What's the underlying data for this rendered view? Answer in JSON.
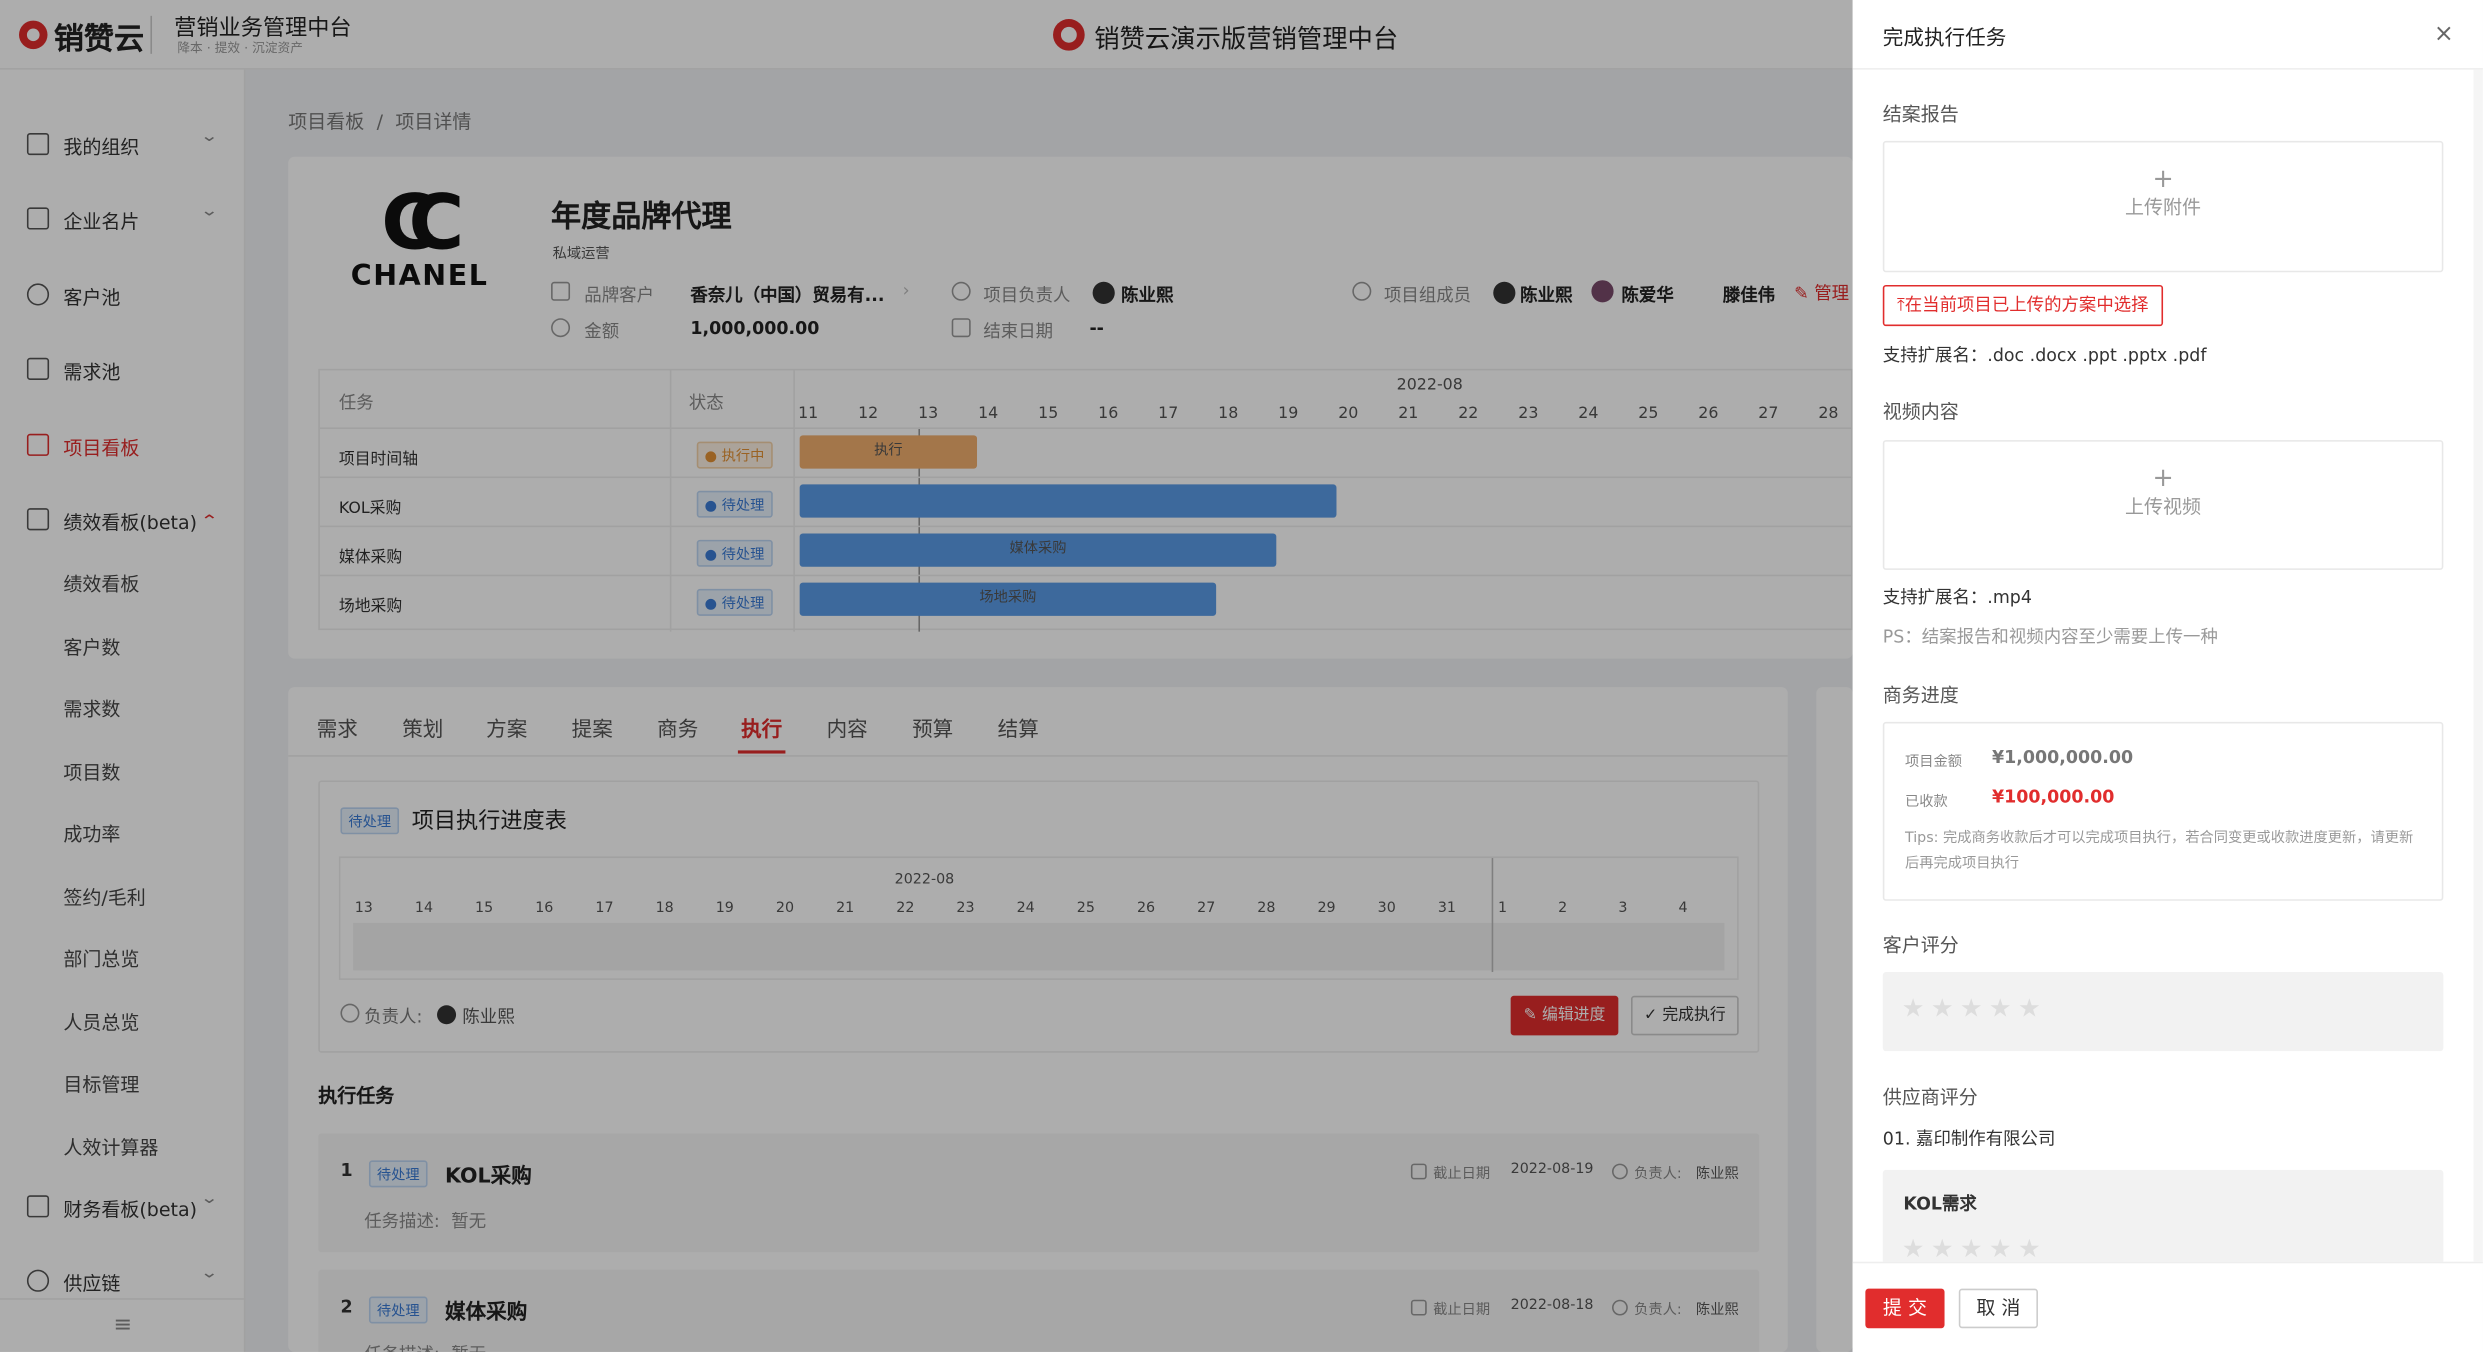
{
  "header": {
    "logo_text": "销赞云",
    "system_title": "营销业务管理中台",
    "system_sub": "降本 · 提效 · 沉淀资产",
    "center_title": "销赞云演示版营销管理中台"
  },
  "sidebar": {
    "items": [
      {
        "label": "我的组织",
        "icon": "org-icon"
      },
      {
        "label": "企业名片",
        "icon": "building-icon"
      },
      {
        "label": "客户池",
        "icon": "user-icon"
      },
      {
        "label": "需求池",
        "icon": "list-icon"
      },
      {
        "label": "项目看板",
        "icon": "board-icon"
      },
      {
        "label": "绩效看板(beta)",
        "icon": "chart-icon"
      },
      {
        "label": "财务看板(beta)",
        "icon": "yen-icon"
      },
      {
        "label": "供应链",
        "icon": "network-icon"
      }
    ],
    "sub_items": [
      "绩效看板",
      "客户数",
      "需求数",
      "项目数",
      "成功率",
      "签约/毛利",
      "部门总览",
      "人员总览",
      "目标管理",
      "人效计算器"
    ],
    "collapse": "≡"
  },
  "breadcrumb": {
    "root": "项目看板",
    "sep": "/",
    "current": "项目详情"
  },
  "project": {
    "logo_text": "CHANEL",
    "title": "年度品牌代理",
    "tag": "私域运营",
    "brand_label": "品牌客户",
    "brand_value": "香奈儿（中国）贸易有...",
    "amount_label": "金额",
    "amount_value": "1,000,000.00",
    "owner_label": "项目负责人",
    "owner_value": "陈业熙",
    "end_label": "结束日期",
    "end_value": "--",
    "members_label": "项目组成员",
    "members": [
      "陈业熙",
      "陈爱华",
      "滕佳伟"
    ],
    "manage": "管理"
  },
  "gantt": {
    "col_task": "任务",
    "col_status": "状态",
    "month": "2022-08",
    "days": [
      "11",
      "12",
      "13",
      "14",
      "15",
      "16",
      "17",
      "18",
      "19",
      "20",
      "21",
      "22",
      "23",
      "24",
      "25",
      "26",
      "27",
      "28"
    ],
    "rows": [
      {
        "task": "项目时间轴",
        "status": "执行中",
        "bar_label": "执行"
      },
      {
        "task": "KOL采购",
        "status": "待处理",
        "bar_label": ""
      },
      {
        "task": "媒体采购",
        "status": "待处理",
        "bar_label": "媒体采购"
      },
      {
        "task": "场地采购",
        "status": "待处理",
        "bar_label": "场地采购"
      }
    ]
  },
  "tabs": [
    "需求",
    "策划",
    "方案",
    "提案",
    "商务",
    "执行",
    "内容",
    "预算",
    "结算"
  ],
  "progress": {
    "badge": "待处理",
    "title": "项目执行进度表",
    "month": "2022-08",
    "days": [
      "13",
      "14",
      "15",
      "16",
      "17",
      "18",
      "19",
      "20",
      "21",
      "22",
      "23",
      "24",
      "25",
      "26",
      "27",
      "28",
      "29",
      "30",
      "31",
      "1",
      "2",
      "3",
      "4"
    ],
    "owner_label": "负责人:",
    "owner": "陈业熙",
    "edit_btn": "编辑进度",
    "done_btn": "完成执行"
  },
  "tasks": {
    "section_title": "执行任务",
    "items": [
      {
        "no": "1",
        "badge": "待处理",
        "name": "KOL采购",
        "desc_label": "任务描述:",
        "desc": "暂无",
        "due_label": "截止日期",
        "due": "2022-08-19",
        "owner_label": "负责人:",
        "owner": "陈业熙"
      },
      {
        "no": "2",
        "badge": "待处理",
        "name": "媒体采购",
        "desc_label": "任务描述:",
        "desc": "暂无",
        "due_label": "截止日期",
        "due": "2022-08-18",
        "owner_label": "负责人:",
        "owner": "陈业熙"
      }
    ]
  },
  "drawer": {
    "title": "完成执行任务",
    "close": "×",
    "report_label": "结案报告",
    "upload_attach": "上传附件",
    "select_btn": "⤒在当前项目已上传的方案中选择",
    "report_ext": "支持扩展名：.doc .docx .ppt .pptx .pdf",
    "video_label": "视频内容",
    "upload_video": "上传视频",
    "video_ext": "支持扩展名：.mp4",
    "ps": "PS：结案报告和视频内容至少需要上传一种",
    "biz_label": "商务进度",
    "amount_label": "项目金额",
    "amount": "¥1,000,000.00",
    "received_label": "已收款",
    "received": "¥100,000.00",
    "tips": "Tips: 完成商务收款后才可以完成项目执行，若合同变更或收款进度更新，请更新后再完成项目执行",
    "rating_label": "客户评分",
    "supplier_label": "供应商评分",
    "supplier": "01. 嘉印制作有限公司",
    "kol_label": "KOL需求",
    "submit": "提 交",
    "cancel": "取 消"
  },
  "colors": {
    "accent": "#e12d2d",
    "blue_bar": "#5b9be6",
    "orange_bar": "#f0ae6e"
  }
}
